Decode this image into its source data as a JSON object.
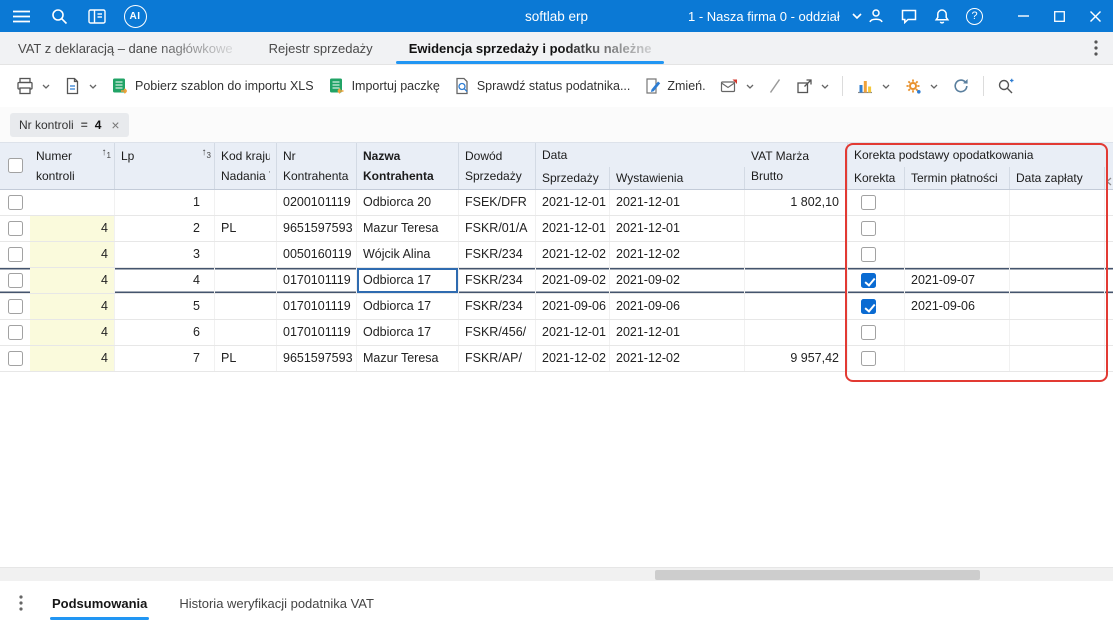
{
  "titlebar": {
    "app_title": "softlab erp",
    "company": "1 - Nasza firma 0 - oddział",
    "ai_badge": "AI",
    "help_mark": "?"
  },
  "tabs": [
    {
      "label": "VAT z deklaracją – dane nagłówkowe"
    },
    {
      "label": "Rejestr sprzedaży"
    },
    {
      "label": "Ewidencja sprzedaży i podatku należne"
    }
  ],
  "toolbar": {
    "template_label": "Pobierz szablon do importu XLS",
    "import_label": "Importuj paczkę",
    "status_label": "Sprawdź status podatnika...",
    "change_label": "Zmień."
  },
  "filter_chip": {
    "field": "Nr kontroli",
    "operator": "=",
    "value": "4"
  },
  "table": {
    "headers": {
      "sort_arrow": "↑",
      "numer_l1": "Numer",
      "numer_l2": "kontroli",
      "numer_sort": "1",
      "lp_l1": "Lp",
      "lp_sort": "3",
      "kod_l1": "Kod kraju",
      "kod_l2": "Nadania TIN",
      "nr_l1": "Nr",
      "nr_l2": "Kontrahenta",
      "nazwa_l1": "Nazwa",
      "nazwa_l2": "Kontrahenta",
      "dowod_l1": "Dowód",
      "dowod_l2": "Sprzedaży",
      "data_group": "Data",
      "data_sub": [
        "Sprzedaży",
        "Wystawienia"
      ],
      "vat_l1": "VAT Marża",
      "vat_l2": "Brutto",
      "korekta_group": "Korekta podstawy opodatkowania",
      "korekta_sub": [
        "Korekta",
        "Termin płatności",
        "Data zapłaty"
      ]
    },
    "rows": [
      {
        "numer": "",
        "lp": "1",
        "kod": "",
        "nr": "0200101119",
        "nazwa": "Odbiorca 20",
        "dowod": "FSEK/DFR",
        "sprzedazy": "2021-12-01",
        "wystawienia": "2021-12-01",
        "vat": "1 802,10",
        "korekta": false,
        "termin": "",
        "zaplata": ""
      },
      {
        "numer": "4",
        "lp": "2",
        "kod": "PL",
        "nr": "9651597593",
        "nazwa": "Mazur Teresa",
        "dowod": "FSKR/01/A",
        "sprzedazy": "2021-12-01",
        "wystawienia": "2021-12-01",
        "vat": "",
        "korekta": false,
        "termin": "",
        "zaplata": ""
      },
      {
        "numer": "4",
        "lp": "3",
        "kod": "",
        "nr": "0050160119",
        "nazwa": "Wójcik Alina",
        "dowod": "FSKR/234",
        "sprzedazy": "2021-12-02",
        "wystawienia": "2021-12-02",
        "vat": "",
        "korekta": false,
        "termin": "",
        "zaplata": ""
      },
      {
        "numer": "4",
        "lp": "4",
        "kod": "",
        "nr": "0170101119",
        "nazwa": "Odbiorca 17",
        "dowod": "FSKR/234",
        "sprzedazy": "2021-09-02",
        "wystawienia": "2021-09-02",
        "vat": "",
        "korekta": true,
        "termin": "2021-09-07",
        "zaplata": ""
      },
      {
        "numer": "4",
        "lp": "5",
        "kod": "",
        "nr": "0170101119",
        "nazwa": "Odbiorca 17",
        "dowod": "FSKR/234",
        "sprzedazy": "2021-09-06",
        "wystawienia": "2021-09-06",
        "vat": "",
        "korekta": true,
        "termin": "2021-09-06",
        "zaplata": ""
      },
      {
        "numer": "4",
        "lp": "6",
        "kod": "",
        "nr": "0170101119",
        "nazwa": "Odbiorca 17",
        "dowod": "FSKR/456/",
        "sprzedazy": "2021-12-01",
        "wystawienia": "2021-12-01",
        "vat": "",
        "korekta": false,
        "termin": "",
        "zaplata": ""
      },
      {
        "numer": "4",
        "lp": "7",
        "kod": "PL",
        "nr": "9651597593",
        "nazwa": "Mazur Teresa",
        "dowod": "FSKR/AP/",
        "sprzedazy": "2021-12-02",
        "wystawienia": "2021-12-02",
        "vat": "9 957,42",
        "korekta": false,
        "termin": "",
        "zaplata": ""
      }
    ],
    "selected_row_index": 3,
    "focused_cell_key": "nazwa"
  },
  "bottom_tabs": [
    {
      "label": "Podsumowania"
    },
    {
      "label": "Historia weryfikacji podatnika VAT"
    }
  ]
}
